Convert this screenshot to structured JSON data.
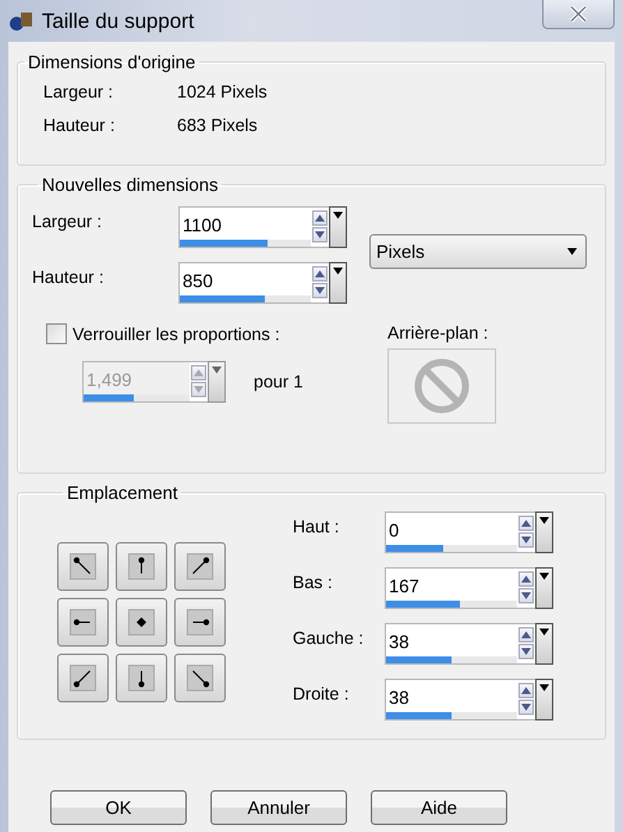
{
  "window": {
    "title": "Taille du support"
  },
  "original": {
    "legend": "Dimensions d'origine",
    "rows": [
      {
        "label": "Largeur :",
        "value": "1024 Pixels"
      },
      {
        "label": "Hauteur :",
        "value": "683 Pixels"
      }
    ]
  },
  "new": {
    "legend": "Nouvelles dimensions",
    "width": {
      "label": "Largeur :",
      "value": "1100",
      "level": 0.67
    },
    "height": {
      "label": "Hauteur :",
      "value": "850",
      "level": 0.65
    },
    "unit": {
      "value": "Pixels"
    },
    "lock": {
      "label": "Verrouiller les proportions :",
      "checked": false
    },
    "ratio": {
      "value": "1,499",
      "level": 0.47,
      "disabled": true,
      "suffix": "pour 1"
    },
    "background": {
      "label": "Arrière-plan :"
    }
  },
  "placement": {
    "legend": "Emplacement",
    "fields": [
      {
        "label": "Haut :",
        "value": "0",
        "level": 0.44
      },
      {
        "label": "Bas :",
        "value": "167",
        "level": 0.56
      },
      {
        "label": "Gauche :",
        "value": "38",
        "level": 0.5
      },
      {
        "label": "Droite :",
        "value": "38",
        "level": 0.5
      }
    ]
  },
  "buttons": [
    "OK",
    "Annuler",
    "Aide"
  ]
}
